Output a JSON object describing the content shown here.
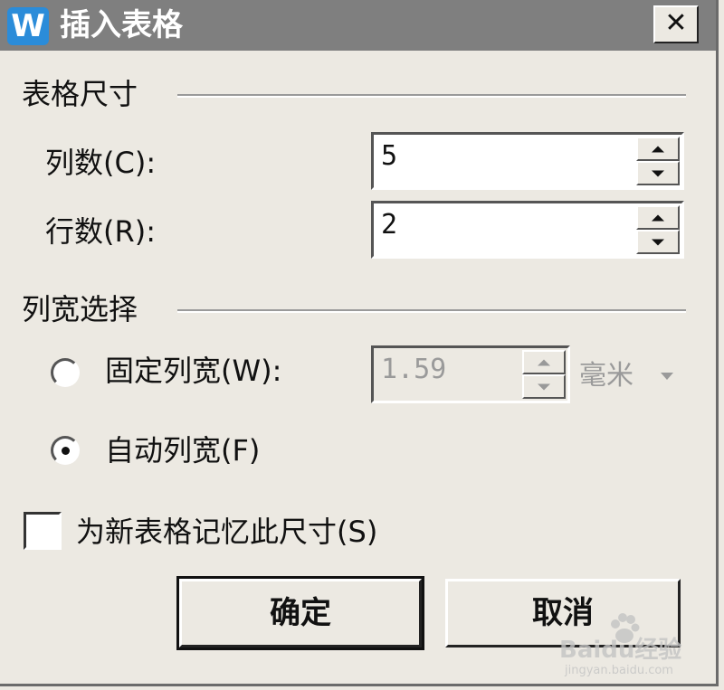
{
  "window": {
    "title": "插入表格",
    "app_icon_letter": "W",
    "close_label": "✕"
  },
  "table_size": {
    "group_title": "表格尺寸",
    "columns": {
      "label": "列数",
      "accel": "(C)",
      "colon": ":",
      "value": "5"
    },
    "rows": {
      "label": "行数",
      "accel": "(R)",
      "colon": ":",
      "value": "2"
    }
  },
  "column_width": {
    "group_title": "列宽选择",
    "fixed": {
      "label": "固定列宽",
      "accel": "(W)",
      "colon": ":",
      "value": "1.59",
      "unit": "毫米",
      "selected": false,
      "enabled": false
    },
    "auto": {
      "label": "自动列宽",
      "accel": "(F)",
      "selected": true
    }
  },
  "remember": {
    "label": "为新表格记忆此尺寸",
    "accel": "(S)",
    "checked": false
  },
  "buttons": {
    "ok": "确定",
    "cancel": "取消"
  },
  "watermark": {
    "main": "Baidu经验",
    "sub": "jingyan.baidu.com"
  },
  "colors": {
    "titlebar": "#7f7f7f",
    "dialog_bg": "#ece9e2",
    "app_icon": "#2b8cd9",
    "disabled_text": "#9a9a9a"
  }
}
